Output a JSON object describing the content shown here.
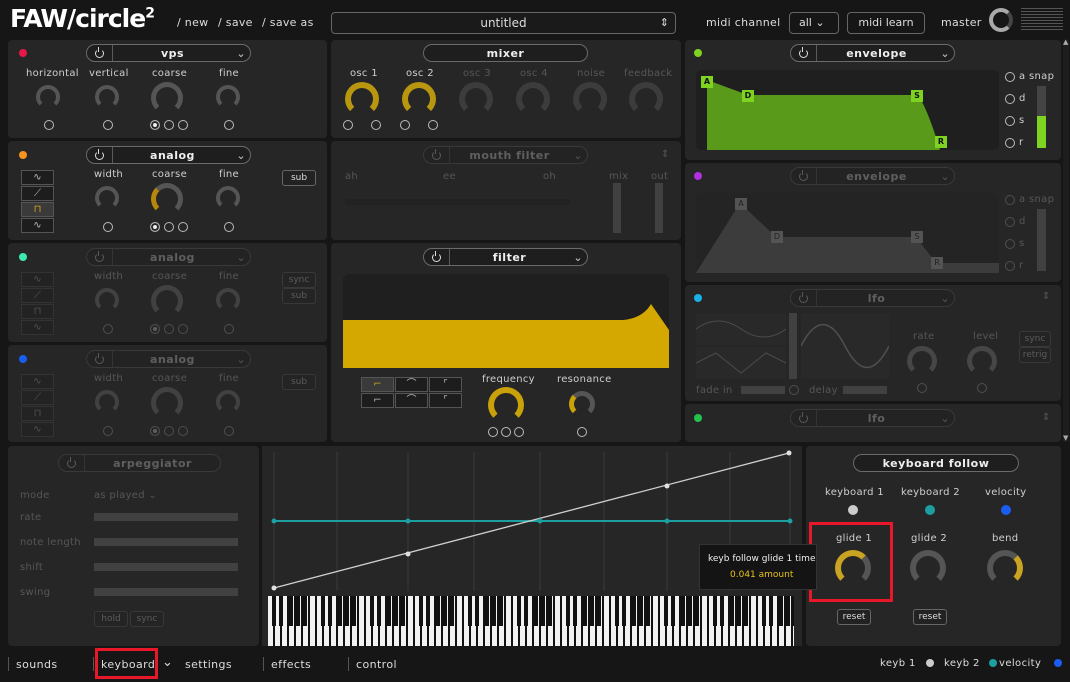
{
  "header": {
    "logo": "FAW/circle",
    "logo_sup": "2",
    "links": [
      "/ new",
      "/ save",
      "/ save as"
    ],
    "preset": "untitled",
    "midi_channel_label": "midi channel",
    "midi_channel_value": "all",
    "midi_learn": "midi learn",
    "master": "master"
  },
  "osc1": {
    "name": "vps",
    "knobs": [
      "horizontal",
      "vertical",
      "coarse",
      "fine"
    ],
    "accent": "#e8174a"
  },
  "osc2": {
    "name": "analog",
    "knobs": [
      "width",
      "coarse",
      "fine"
    ],
    "sub": "sub",
    "accent": "#f7931e",
    "waves": [
      "∿",
      "⟋",
      "⊓",
      "∿"
    ]
  },
  "osc3": {
    "name": "analog",
    "knobs": [
      "width",
      "coarse",
      "fine"
    ],
    "sync": "sync",
    "sub": "sub",
    "accent": "#3de8b0"
  },
  "osc4": {
    "name": "analog",
    "knobs": [
      "width",
      "coarse",
      "fine"
    ],
    "sub": "sub",
    "accent": "#1a5ef0"
  },
  "mixer": {
    "name": "mixer",
    "channels": [
      "osc 1",
      "osc 2",
      "osc 3",
      "osc 4",
      "noise",
      "feedback"
    ]
  },
  "mouth": {
    "name": "mouth filter",
    "selects": [
      "ah",
      "ee",
      "oh"
    ],
    "mix": "mix",
    "out": "out"
  },
  "filter": {
    "name": "filter",
    "frequency": "frequency",
    "resonance": "resonance",
    "color": "#d4a800"
  },
  "env1": {
    "name": "envelope",
    "accent": "#7ed321",
    "points": [
      "A",
      "D",
      "S",
      "R"
    ],
    "opts": [
      "a",
      "d",
      "s",
      "r"
    ],
    "snap": "snap"
  },
  "env2": {
    "name": "envelope",
    "accent": "#b030e0",
    "points": [
      "A",
      "D",
      "S",
      "R"
    ],
    "opts": [
      "a",
      "d",
      "s",
      "r"
    ],
    "snap": "snap"
  },
  "lfo1": {
    "name": "lfo",
    "accent": "#1ab0e8",
    "rate": "rate",
    "level": "level",
    "sync": "sync",
    "retrig": "retrig",
    "fade_in": "fade in",
    "delay": "delay"
  },
  "lfo2": {
    "name": "lfo",
    "accent": "#21c44a"
  },
  "arp": {
    "name": "arpeggiator",
    "rows": [
      "mode",
      "rate",
      "note length",
      "shift",
      "swing"
    ],
    "mode_value": "as played",
    "hold": "hold",
    "sync": "sync"
  },
  "kf": {
    "title": "keyboard follow",
    "sources": [
      "keyboard 1",
      "keyboard 2",
      "velocity"
    ],
    "knobs": [
      "glide 1",
      "glide 2",
      "bend"
    ],
    "reset": "reset",
    "tooltip_title": "keyb follow glide 1 time",
    "tooltip_value": "0.041 amount"
  },
  "tabs": [
    "sounds",
    "keyboard",
    "settings",
    "effects",
    "control"
  ],
  "legend": [
    "keyb 1",
    "keyb 2",
    "velocity"
  ],
  "colors": {
    "gold": "#c9a322",
    "teal": "#1d9ea0",
    "blue": "#1a5ef0",
    "red": "#e8172a"
  }
}
